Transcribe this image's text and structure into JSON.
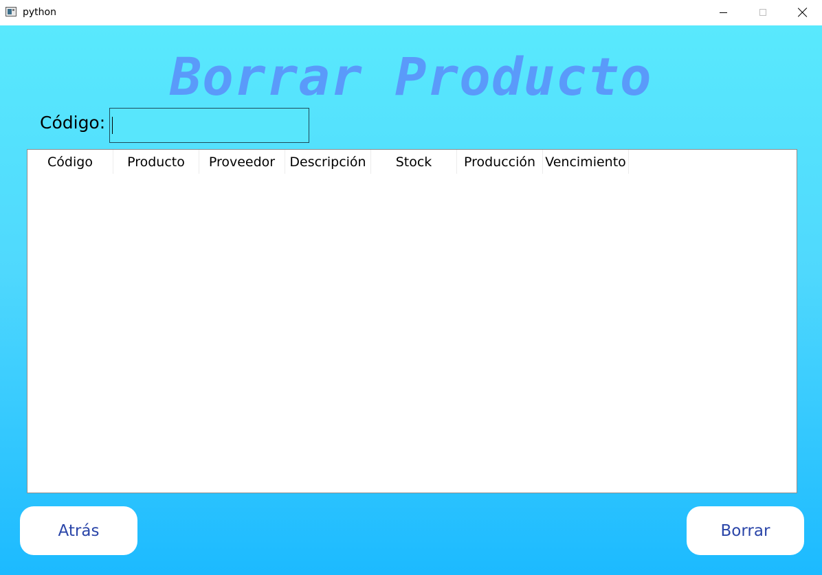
{
  "window": {
    "title": "python",
    "controls": {
      "minimize": "minimize-icon",
      "maximize": "maximize-icon",
      "close": "close-icon"
    }
  },
  "page": {
    "title": "Borrar Producto",
    "code_label": "Código:",
    "code_input_value": "",
    "colors": {
      "background_top": "#59e9fd",
      "background_bottom": "#1cbaff",
      "title": "#5a9afa",
      "button_text": "#2a45a8"
    }
  },
  "table": {
    "columns": [
      "Código",
      "Producto",
      "Proveedor",
      "Descripción",
      "Stock",
      "Producción",
      "Vencimiento"
    ],
    "rows": []
  },
  "buttons": {
    "back_label": "Atrás",
    "delete_label": "Borrar"
  }
}
